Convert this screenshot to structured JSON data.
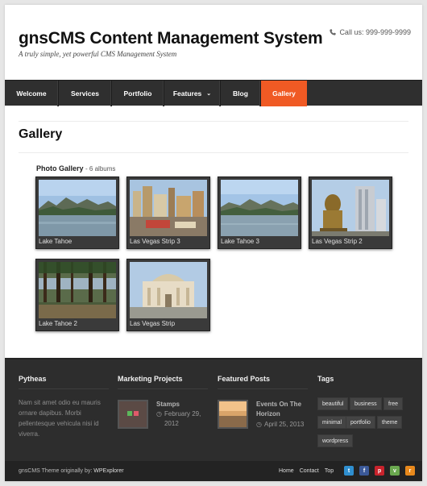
{
  "header": {
    "title": "gnsCMS Content Management System",
    "tagline": "A truly simple, yet powerful CMS Management System",
    "call": "Call us: 999-999-9999",
    "icon": "phone-icon"
  },
  "nav": {
    "items": [
      {
        "label": "Welcome"
      },
      {
        "label": "Services"
      },
      {
        "label": "Portfolio"
      },
      {
        "label": "Features",
        "has_dropdown": true
      },
      {
        "label": "Blog"
      },
      {
        "label": "Gallery",
        "active": true
      }
    ],
    "active_color": "#f05a24",
    "bg_color": "#2f2f2f"
  },
  "main": {
    "page_title": "Gallery",
    "gallery_label": "Photo Gallery",
    "gallery_count": "- 6 albums",
    "albums": [
      {
        "caption": "Lake Tahoe"
      },
      {
        "caption": "Las Vegas Strip 3"
      },
      {
        "caption": "Lake Tahoe 3"
      },
      {
        "caption": "Las Vegas Strip 2"
      },
      {
        "caption": "Lake Tahoe 2"
      },
      {
        "caption": "Las Vegas Strip"
      }
    ]
  },
  "footer": {
    "about": {
      "heading": "Pytheas",
      "text": "Nam sit amet odio eu mauris ornare dapibus. Morbi pellentesque vehicula nisi id viverra."
    },
    "projects": {
      "heading": "Marketing Projects",
      "item_title": "Stamps",
      "item_date": "February 29, 2012"
    },
    "posts": {
      "heading": "Featured Posts",
      "item_title": "Events On The Horizon",
      "item_date": "April 25, 2013"
    },
    "tags": {
      "heading": "Tags",
      "items": [
        "beautiful",
        "business",
        "free",
        "minimal",
        "portfolio",
        "theme",
        "wordpress"
      ]
    }
  },
  "bottom": {
    "credits_prefix": "gnsCMS Theme originally by:",
    "credits_link": "WPExplorer",
    "links": [
      "Home",
      "Contact",
      "Top"
    ],
    "social": [
      {
        "icon": "twitter-icon",
        "glyph": "t",
        "color": "#2f8fd0"
      },
      {
        "icon": "facebook-icon",
        "glyph": "f",
        "color": "#3b5998"
      },
      {
        "icon": "pinterest-icon",
        "glyph": "p",
        "color": "#c8232c"
      },
      {
        "icon": "vimeo-icon",
        "glyph": "v",
        "color": "#6aa84f"
      },
      {
        "icon": "rss-icon",
        "glyph": "r",
        "color": "#e8891c"
      }
    ]
  }
}
